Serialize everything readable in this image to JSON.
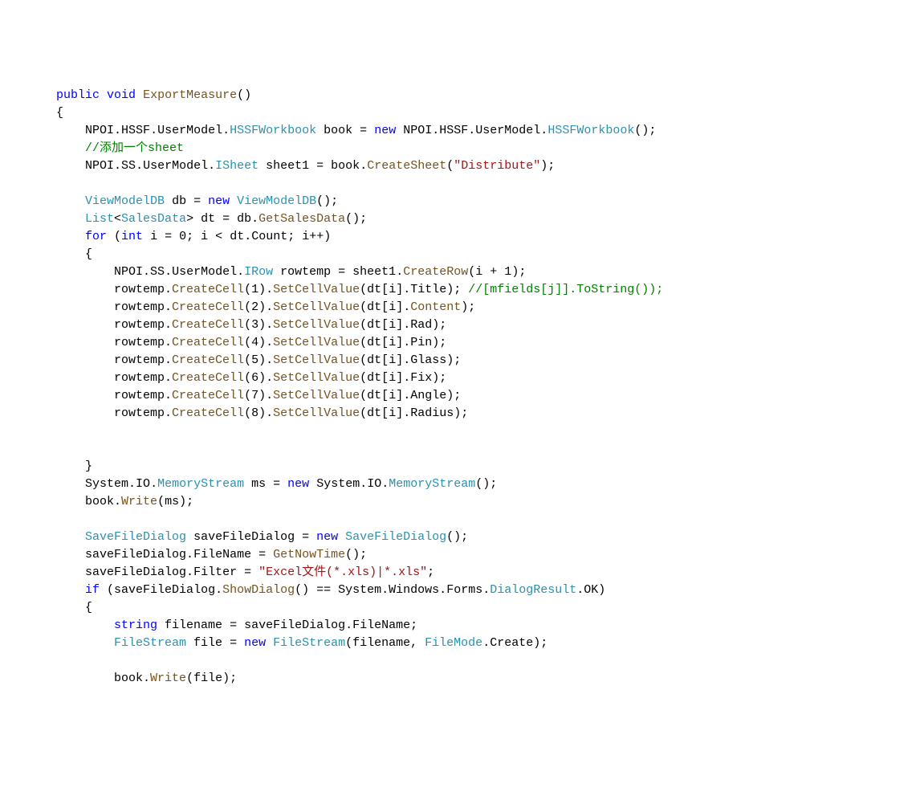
{
  "code": {
    "L1": {
      "k1": "public",
      "k2": "void",
      "m1": "ExportMeasure"
    },
    "L2": {
      "brace": "{"
    },
    "L3": {
      "t1": "NPOI",
      "t2": "HSSF",
      "t3": "UserModel",
      "t4": "HSSFWorkbook",
      "v1": "book",
      "k1": "new",
      "t5": "NPOI",
      "t6": "HSSF",
      "t7": "UserModel",
      "t8": "HSSFWorkbook"
    },
    "L4": {
      "c1": "//添加一个sheet"
    },
    "L5": {
      "t1": "NPOI",
      "t2": "SS",
      "t3": "UserModel",
      "t4": "ISheet",
      "v1": "sheet1",
      "v2": "book",
      "m1": "CreateSheet",
      "s1": "\"Distribute\""
    },
    "L6": {
      "t1": "ViewModelDB",
      "v1": "db",
      "k1": "new",
      "t2": "ViewModelDB"
    },
    "L7": {
      "t1": "List",
      "t2": "SalesData",
      "v1": "dt",
      "v2": "db",
      "m1": "GetSalesData"
    },
    "L8": {
      "k1": "for",
      "k2": "int",
      "v1": "i",
      "n1": "0",
      "v2": "i",
      "op1": "<",
      "v3": "dt",
      "p1": "Count",
      "v4": "i",
      "op2": "++"
    },
    "L9": {
      "brace": "{"
    },
    "L10": {
      "t1": "NPOI",
      "t2": "SS",
      "t3": "UserModel",
      "t4": "IRow",
      "v1": "rowtemp",
      "v2": "sheet1",
      "m1": "CreateRow",
      "v3": "i",
      "op1": "+",
      "n1": "1"
    },
    "L11": {
      "v1": "rowtemp",
      "m1": "CreateCell",
      "n1": "1",
      "m2": "SetCellValue",
      "v2": "dt",
      "v3": "i",
      "p1": "Title",
      "c1": "//[mfields[j]].ToString());"
    },
    "L12": {
      "v1": "rowtemp",
      "m1": "CreateCell",
      "n1": "2",
      "m2": "SetCellValue",
      "v2": "dt",
      "v3": "i",
      "p1": "Content"
    },
    "L13": {
      "v1": "rowtemp",
      "m1": "CreateCell",
      "n1": "3",
      "m2": "SetCellValue",
      "v2": "dt",
      "v3": "i",
      "p1": "Rad"
    },
    "L14": {
      "v1": "rowtemp",
      "m1": "CreateCell",
      "n1": "4",
      "m2": "SetCellValue",
      "v2": "dt",
      "v3": "i",
      "p1": "Pin"
    },
    "L15": {
      "v1": "rowtemp",
      "m1": "CreateCell",
      "n1": "5",
      "m2": "SetCellValue",
      "v2": "dt",
      "v3": "i",
      "p1": "Glass"
    },
    "L16": {
      "v1": "rowtemp",
      "m1": "CreateCell",
      "n1": "6",
      "m2": "SetCellValue",
      "v2": "dt",
      "v3": "i",
      "p1": "Fix"
    },
    "L17": {
      "v1": "rowtemp",
      "m1": "CreateCell",
      "n1": "7",
      "m2": "SetCellValue",
      "v2": "dt",
      "v3": "i",
      "p1": "Angle"
    },
    "L18": {
      "v1": "rowtemp",
      "m1": "CreateCell",
      "n1": "8",
      "m2": "SetCellValue",
      "v2": "dt",
      "v3": "i",
      "p1": "Radius"
    },
    "L19": {
      "brace": "}"
    },
    "L20": {
      "t1": "System",
      "t2": "IO",
      "t3": "MemoryStream",
      "v1": "ms",
      "k1": "new",
      "t4": "System",
      "t5": "IO",
      "t6": "MemoryStream"
    },
    "L21": {
      "v1": "book",
      "m1": "Write",
      "v2": "ms"
    },
    "L22": {
      "t1": "SaveFileDialog",
      "v1": "saveFileDialog",
      "k1": "new",
      "t2": "SaveFileDialog"
    },
    "L23": {
      "v1": "saveFileDialog",
      "p1": "FileName",
      "m1": "GetNowTime"
    },
    "L24": {
      "v1": "saveFileDialog",
      "p1": "Filter",
      "s1": "\"Excel文件(*.xls)|*.xls\""
    },
    "L25": {
      "k1": "if",
      "v1": "saveFileDialog",
      "m1": "ShowDialog",
      "t1": "System",
      "t2": "Windows",
      "t3": "Forms",
      "t4": "DialogResult",
      "p1": "OK"
    },
    "L26": {
      "brace": "{"
    },
    "L27": {
      "k1": "string",
      "v1": "filename",
      "v2": "saveFileDialog",
      "p1": "FileName"
    },
    "L28": {
      "t1": "FileStream",
      "v1": "file",
      "k1": "new",
      "t2": "FileStream",
      "v2": "filename",
      "t3": "FileMode",
      "p1": "Create"
    },
    "L29": {
      "v1": "book",
      "m1": "Write",
      "v2": "file"
    }
  }
}
